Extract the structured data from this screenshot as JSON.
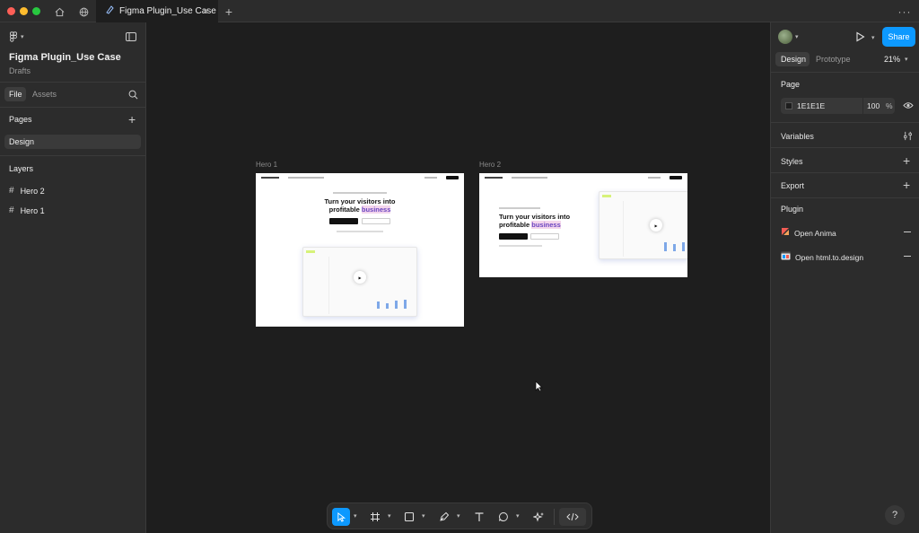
{
  "tab": {
    "title": "Figma Plugin_Use Case"
  },
  "file": {
    "name": "Figma Plugin_Use Case",
    "location": "Drafts"
  },
  "left_tabs": {
    "file": "File",
    "assets": "Assets"
  },
  "pages": {
    "heading": "Pages",
    "items": [
      "Design"
    ]
  },
  "layers": {
    "heading": "Layers",
    "items": [
      "Hero 2",
      "Hero 1"
    ]
  },
  "right": {
    "tabs": {
      "design": "Design",
      "prototype": "Prototype"
    },
    "zoom": "21%",
    "share_label": "Share",
    "page_section": "Page",
    "page_color": "1E1E1E",
    "page_opacity": "100",
    "page_opacity_unit": "%",
    "sections": {
      "variables": "Variables",
      "styles": "Styles",
      "export": "Export",
      "plugin": "Plugin"
    },
    "plugins": [
      "Open Anima",
      "Open html.to.design"
    ]
  },
  "canvas": {
    "frames": [
      {
        "label": "Hero 1",
        "headline_1": "Turn your visitors into",
        "headline_2": "profitable",
        "headline_accent": "business"
      },
      {
        "label": "Hero 2",
        "headline_1": "Turn your visitors into",
        "headline_2": "profitable",
        "headline_accent": "business"
      }
    ]
  },
  "help_label": "?",
  "colors": {
    "accent": "#0d99ff",
    "panel": "#2c2c2c",
    "canvas": "#1e1e1e",
    "anima": "#f25c54"
  }
}
